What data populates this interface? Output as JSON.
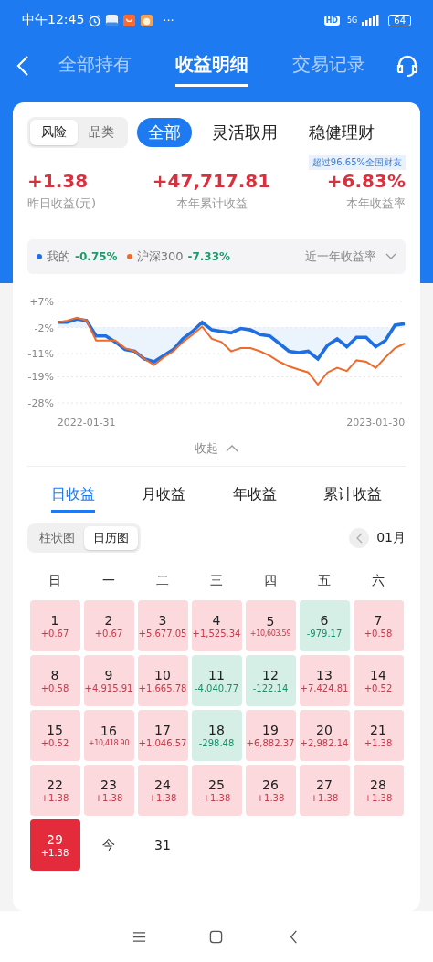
{
  "status_bar": {
    "time": "中午12:45",
    "more": "···",
    "hd": "HD",
    "network": "5G",
    "battery": "64"
  },
  "nav": {
    "tabs": [
      {
        "label": "全部持有",
        "selected": false
      },
      {
        "label": "收益明细",
        "selected": true
      },
      {
        "label": "交易记录",
        "selected": false
      }
    ]
  },
  "filter": {
    "segments": [
      {
        "label": "风险",
        "selected": true
      },
      {
        "label": "品类",
        "selected": false
      }
    ],
    "categories": [
      {
        "label": "全部",
        "selected": true
      },
      {
        "label": "灵活取用",
        "selected": false
      },
      {
        "label": "稳健理财",
        "selected": false
      }
    ]
  },
  "rank_badge": "超过96.65%全国财友",
  "stats": [
    {
      "value": "+1.38",
      "label": "昨日收益(元)"
    },
    {
      "value": "+47,717.81",
      "label": "本年累计收益"
    },
    {
      "value": "+6.83%",
      "label": "本年收益率"
    }
  ],
  "legend": [
    {
      "value": "-0.75%"
    },
    {
      "value": "-7.33%"
    }
  ],
  "range": "近一年收益率",
  "chart_data": {
    "type": "line",
    "categories": [
      null,
      null,
      null,
      "2022-01-31",
      null,
      null,
      null,
      null,
      null,
      null,
      null,
      null,
      null,
      null,
      null,
      null,
      null,
      null,
      null,
      null,
      null,
      null,
      null,
      null,
      null,
      null,
      null,
      null,
      null,
      null,
      null,
      null,
      null,
      "2023-01-30",
      null,
      null,
      null
    ],
    "ylim": [
      -28,
      7
    ],
    "grid": true,
    "yticks": [
      {
        "value": 7,
        "label": "+7%"
      },
      {
        "value": -2,
        "label": "-2%"
      },
      {
        "value": -11,
        "label": "-11%"
      },
      {
        "value": -19,
        "label": "-19%"
      },
      {
        "value": -28,
        "label": "-28%"
      }
    ],
    "series": [
      {
        "name": "我的",
        "color": "#1f6fe0",
        "values": [
          -0.2,
          -0.2,
          0.9,
          0.4,
          -4.9,
          -4.9,
          -7.0,
          -9.6,
          -10.2,
          -12.8,
          -13.8,
          -11.7,
          -9.6,
          -5.9,
          -3.3,
          -0.2,
          -2.8,
          -3.3,
          -3.8,
          -2.3,
          -2.8,
          -4.4,
          -4.9,
          -7.5,
          -10.2,
          -10.7,
          -10.2,
          -12.8,
          -8.1,
          -5.9,
          -8.6,
          -5.4,
          -5.4,
          -8.6,
          -6.5,
          -1.2,
          -0.7
        ]
      },
      {
        "name": "沪深300",
        "color": "#f06a2a",
        "values": [
          -0.2,
          0.4,
          1.4,
          0.4,
          -6.5,
          -6.5,
          -6.5,
          -9.1,
          -10.2,
          -12.8,
          -14.9,
          -12.3,
          -10.2,
          -7.0,
          -4.4,
          -1.7,
          -5.9,
          -7.0,
          -10.2,
          -9.1,
          -9.1,
          -10.2,
          -11.7,
          -13.8,
          -15.4,
          -16.5,
          -17.5,
          -21.7,
          -17.5,
          -15.9,
          -17.0,
          -13.3,
          -13.8,
          -15.9,
          -12.3,
          -9.1,
          -7.5
        ]
      }
    ]
  },
  "collapse": "收起",
  "period_tabs": [
    {
      "label": "日收益",
      "selected": true
    },
    {
      "label": "月收益",
      "selected": false
    },
    {
      "label": "年收益",
      "selected": false
    },
    {
      "label": "累计收益",
      "selected": false
    }
  ],
  "view_toggle": [
    {
      "label": "柱状图",
      "selected": false
    },
    {
      "label": "日历图",
      "selected": true
    }
  ],
  "month": "01月",
  "weekdays": [
    "日",
    "一",
    "二",
    "三",
    "四",
    "五",
    "六"
  ],
  "days": [
    {
      "day": "1",
      "value": "+0.67",
      "gain": true,
      "selected": false
    },
    {
      "day": "2",
      "value": "+0.67",
      "gain": true,
      "selected": false
    },
    {
      "day": "3",
      "value": "+5,677.05",
      "gain": true,
      "selected": false
    },
    {
      "day": "4",
      "value": "+1,525.34",
      "gain": true,
      "selected": false
    },
    {
      "day": "5",
      "value": "+10,603.59",
      "gain": true,
      "selected": false
    },
    {
      "day": "6",
      "value": "-979.17",
      "gain": false,
      "selected": false
    },
    {
      "day": "7",
      "value": "+0.58",
      "gain": true,
      "selected": false
    },
    {
      "day": "8",
      "value": "+0.58",
      "gain": true,
      "selected": false
    },
    {
      "day": "9",
      "value": "+4,915.91",
      "gain": true,
      "selected": false
    },
    {
      "day": "10",
      "value": "+1,665.78",
      "gain": true,
      "selected": false
    },
    {
      "day": "11",
      "value": "-4,040.77",
      "gain": false,
      "selected": false
    },
    {
      "day": "12",
      "value": "-122.14",
      "gain": false,
      "selected": false
    },
    {
      "day": "13",
      "value": "+7,424.81",
      "gain": true,
      "selected": false
    },
    {
      "day": "14",
      "value": "+0.52",
      "gain": true,
      "selected": false
    },
    {
      "day": "15",
      "value": "+0.52",
      "gain": true,
      "selected": false
    },
    {
      "day": "16",
      "value": "+10,418.90",
      "gain": true,
      "selected": false
    },
    {
      "day": "17",
      "value": "+1,046.57",
      "gain": true,
      "selected": false
    },
    {
      "day": "18",
      "value": "-298.48",
      "gain": false,
      "selected": false
    },
    {
      "day": "19",
      "value": "+6,882.37",
      "gain": true,
      "selected": false
    },
    {
      "day": "20",
      "value": "+2,982.14",
      "gain": true,
      "selected": false
    },
    {
      "day": "21",
      "value": "+1.38",
      "gain": true,
      "selected": false
    },
    {
      "day": "22",
      "value": "+1.38",
      "gain": true,
      "selected": false
    },
    {
      "day": "23",
      "value": "+1.38",
      "gain": true,
      "selected": false
    },
    {
      "day": "24",
      "value": "+1.38",
      "gain": true,
      "selected": false
    },
    {
      "day": "25",
      "value": "+1.38",
      "gain": true,
      "selected": false
    },
    {
      "day": "26",
      "value": "+1.38",
      "gain": true,
      "selected": false
    },
    {
      "day": "27",
      "value": "+1.38",
      "gain": true,
      "selected": false
    },
    {
      "day": "28",
      "value": "+1.38",
      "gain": true,
      "selected": false
    },
    {
      "day": "29",
      "value": "+1.38",
      "gain": true,
      "selected": true
    },
    {
      "day": "今"
    },
    {
      "day": "31"
    }
  ]
}
